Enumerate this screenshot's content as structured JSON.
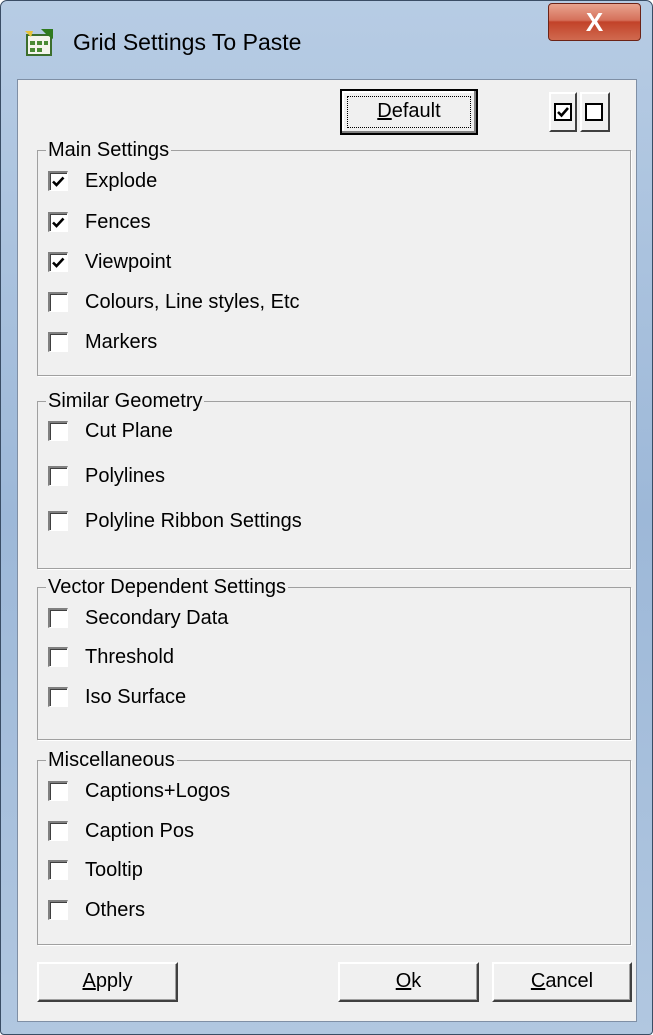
{
  "window": {
    "title": "Grid Settings To Paste",
    "close_glyph": "X"
  },
  "toolbar": {
    "default_label": "Default",
    "default_mnemonic": "D",
    "default_rest": "efault",
    "check_all_icon": "checked-box-icon",
    "uncheck_all_icon": "empty-box-icon"
  },
  "groups": [
    {
      "title": "Main Settings",
      "items": [
        {
          "label": "Explode",
          "checked": true
        },
        {
          "label": "Fences",
          "checked": true
        },
        {
          "label": "Viewpoint",
          "checked": true
        },
        {
          "label": "Colours,  Line styles, Etc",
          "checked": false
        },
        {
          "label": "Markers",
          "checked": false
        }
      ]
    },
    {
      "title": "Similar Geometry",
      "items": [
        {
          "label": "Cut Plane",
          "checked": false
        },
        {
          "label": "Polylines",
          "checked": false
        },
        {
          "label": "Polyline Ribbon Settings",
          "checked": false
        }
      ]
    },
    {
      "title": "Vector Dependent Settings",
      "items": [
        {
          "label": "Secondary Data",
          "checked": false
        },
        {
          "label": "Threshold",
          "checked": false
        },
        {
          "label": "Iso Surface",
          "checked": false
        }
      ]
    },
    {
      "title": "Miscellaneous",
      "items": [
        {
          "label": "Captions+Logos",
          "checked": false
        },
        {
          "label": "Caption Pos",
          "checked": false
        },
        {
          "label": "Tooltip",
          "checked": false
        },
        {
          "label": "Others",
          "checked": false
        }
      ]
    }
  ],
  "footer": {
    "apply": {
      "mnemonic": "A",
      "rest": "pply"
    },
    "ok": {
      "mnemonic": "O",
      "rest": "k"
    },
    "cancel": {
      "mnemonic": "C",
      "rest": "ancel"
    }
  }
}
